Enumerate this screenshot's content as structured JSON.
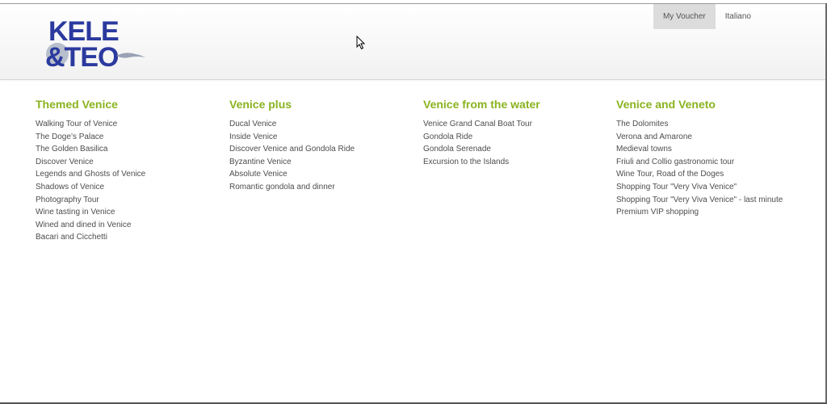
{
  "header": {
    "logo_text_line1": "KELE",
    "logo_text_line2": "&TEO",
    "nav": [
      {
        "label": "My Voucher",
        "active": true
      },
      {
        "label": "Italiano",
        "active": false
      }
    ]
  },
  "colors": {
    "accent_green": "#8ab31f",
    "logo_blue": "#2b3a9e",
    "link_text": "#4d4d4d"
  },
  "menu": {
    "columns": [
      {
        "title": "Themed Venice",
        "items": [
          "Walking Tour of Venice",
          "The Doge’s Palace",
          "The Golden Basilica",
          "Discover Venice",
          "Legends and Ghosts of Venice",
          "Shadows of Venice",
          "Photography Tour",
          "Wine tasting in Venice",
          "Wined and dined in Venice",
          "Bacari and Cicchetti"
        ]
      },
      {
        "title": "Venice plus",
        "items": [
          "Ducal Venice",
          "Inside Venice",
          "Discover Venice and Gondola Ride",
          "Byzantine Venice",
          "Absolute Venice",
          "Romantic gondola and dinner"
        ]
      },
      {
        "title": "Venice from the water",
        "items": [
          "Venice Grand Canal Boat Tour",
          "Gondola Ride",
          "Gondola Serenade",
          "Excursion to the Islands"
        ]
      },
      {
        "title": "Venice and Veneto",
        "items": [
          "The Dolomites",
          "Verona and Amarone",
          "Medieval towns",
          "Friuli and Collio gastronomic tour",
          "Wine Tour, Road of the Doges",
          "Shopping Tour \"Very Viva Venice\"",
          "Shopping Tour \"Very Viva Venice\" - last minute",
          "Premium VIP shopping"
        ]
      }
    ]
  }
}
